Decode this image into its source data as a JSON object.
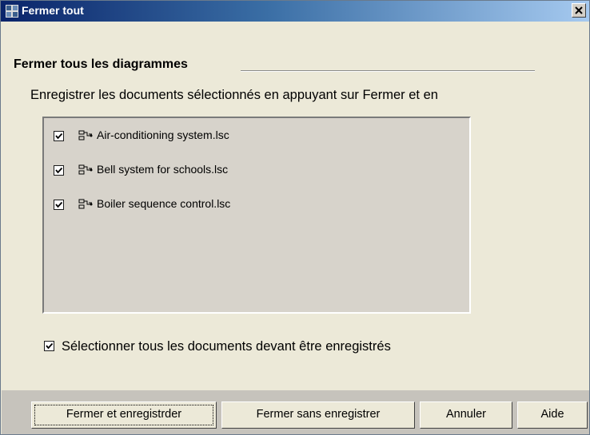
{
  "window": {
    "title": "Fermer tout",
    "close_label": "×"
  },
  "app_icon": {
    "name": "logo-app-icon",
    "letters": "LOGO"
  },
  "section": {
    "heading": "Fermer tous les diagrammes",
    "description": "Enregistrer les documents sélectionnés en appuyant sur Fermer et en"
  },
  "documents": [
    {
      "name": "Air-conditioning system.lsc",
      "checked": true,
      "icon": "diagram-icon"
    },
    {
      "name": "Bell system for schools.lsc",
      "checked": true,
      "icon": "diagram-icon"
    },
    {
      "name": "Boiler sequence control.lsc",
      "checked": true,
      "icon": "diagram-icon"
    }
  ],
  "select_all": {
    "label": "Sélectionner tous les documents devant être enregistrés",
    "checked": true
  },
  "buttons": {
    "save_close": "Fermer et enregistrder",
    "close_no_save": "Fermer sans enregistrer",
    "cancel": "Annuler",
    "help": "Aide"
  },
  "colors": {
    "title_start": "#0a246a",
    "title_end": "#a6caf0",
    "dialog_bg": "#ece9d8",
    "list_bg": "#d7d3cb"
  }
}
